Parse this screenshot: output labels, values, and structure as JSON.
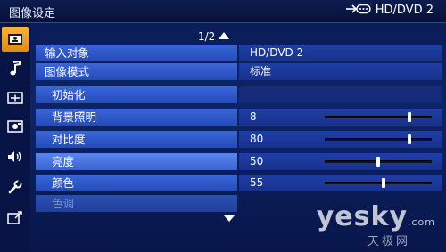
{
  "header": {
    "title": "图像设定",
    "input_indicator": "HD/DVD 2"
  },
  "page_indicator": "1/2",
  "menu": {
    "rows": [
      {
        "label": "输入对象",
        "value": "HD/DVD 2"
      },
      {
        "label": "图像模式",
        "value": "标准"
      },
      {
        "label": "初始化",
        "value": ""
      },
      {
        "label": "背景照明",
        "value": "8",
        "level": 8,
        "max": 10
      },
      {
        "label": "对比度",
        "value": "80",
        "level": 80,
        "max": 100
      },
      {
        "label": "亮度",
        "value": "50",
        "level": 50,
        "max": 100
      },
      {
        "label": "颜色",
        "value": "55",
        "level": 55,
        "max": 100
      },
      {
        "label": "色调",
        "value": ""
      }
    ]
  },
  "sidebar": {
    "icons": [
      "picture-icon",
      "music-note-icon",
      "screen-icon",
      "camera-icon",
      "speaker-icon",
      "wrench-icon",
      "input-icon"
    ],
    "active": 0
  },
  "colors": {
    "accent": "#f0a22a",
    "label_bg": "#2f58c8",
    "value_bg": "#1a3694"
  },
  "watermark": {
    "brand": "yesky",
    "suffix": ".com",
    "sub": "天极网"
  }
}
